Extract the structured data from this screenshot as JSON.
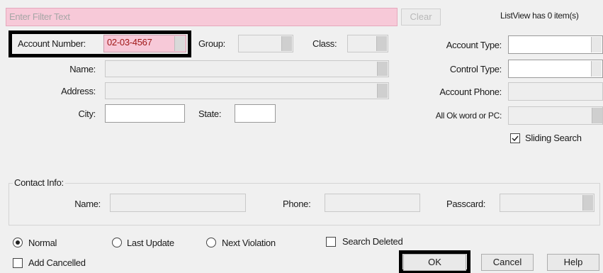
{
  "filter": {
    "placeholder": "Enter Filter Text",
    "clear_label": "Clear",
    "listview_status": "ListView has 0 item(s)"
  },
  "fields": {
    "account_number_label": "Account Number:",
    "account_number_value": "02-03-4567",
    "group_label": "Group:",
    "class_label": "Class:",
    "name_label": "Name:",
    "address_label": "Address:",
    "city_label": "City:",
    "state_label": "State:",
    "account_type_label": "Account Type:",
    "control_type_label": "Control Type:",
    "account_phone_label": "Account Phone:",
    "all_ok_label": "All Ok word or PC:",
    "sliding_search_label": "Sliding Search"
  },
  "contact": {
    "section_label": "Contact Info:",
    "name_label": "Name:",
    "phone_label": "Phone:",
    "passcard_label": "Passcard:"
  },
  "options": {
    "normal": "Normal",
    "last_update": "Last Update",
    "next_violation": "Next Violation",
    "search_deleted": "Search Deleted",
    "add_cancelled": "Add Cancelled"
  },
  "buttons": {
    "ok": "OK",
    "cancel": "Cancel",
    "help": "Help"
  },
  "state": {
    "selected_search_mode": "normal",
    "sliding_search_checked": true,
    "search_deleted_checked": false,
    "add_cancelled_checked": false
  },
  "colors": {
    "filter_bg": "#f7c9d8",
    "account_number_bg": "#f7c9d8",
    "highlight": "#000000"
  }
}
